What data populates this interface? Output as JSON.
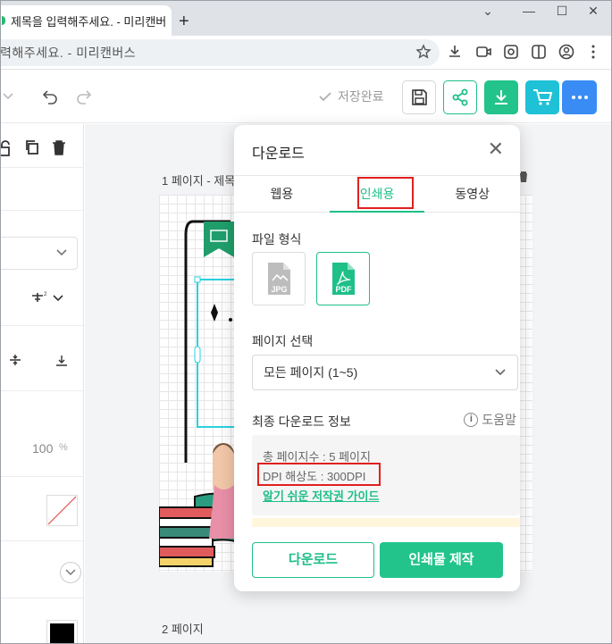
{
  "browser": {
    "tab_title": "제목을 입력해주세요. - 미리캔버",
    "new_tab": "+",
    "minimize": "⌄",
    "restore": "—",
    "maximize": "☐",
    "close": "✕",
    "address": "력해주세요. - 미리캔버스"
  },
  "toolbar": {
    "save_status": "저장완료",
    "accent_colors": {
      "share": "#1fbf88",
      "download": "#22c48c",
      "cart": "#1ec1d6",
      "more": "#3a8cf5"
    }
  },
  "left_panel": {
    "opacity_value": "100",
    "opacity_unit": "%"
  },
  "canvas": {
    "page1_label": "1 페이지 - 제목",
    "page2_label": "2 페이지"
  },
  "modal": {
    "title": "다운로드",
    "close": "✕",
    "tabs": [
      {
        "label": "웹용"
      },
      {
        "label": "인쇄용"
      },
      {
        "label": "동영상"
      }
    ],
    "active_tab": "인쇄용",
    "file_format_label": "파일 형식",
    "formats": [
      {
        "label": "JPG",
        "selected": false
      },
      {
        "label": "PDF",
        "selected": true
      }
    ],
    "page_select_label": "페이지 선택",
    "page_select_value": "모든 페이지 (1~5)",
    "final_info_label": "최종 다운로드 정보",
    "help_label": "도움말",
    "total_pages": "총 페이지수 : 5 페이지",
    "dpi": "DPI 해상도 : 300DPI",
    "guide_link": "알기 쉬운 저작권 가이드",
    "download_button": "다운로드",
    "print_button": "인쇄물 제작"
  }
}
